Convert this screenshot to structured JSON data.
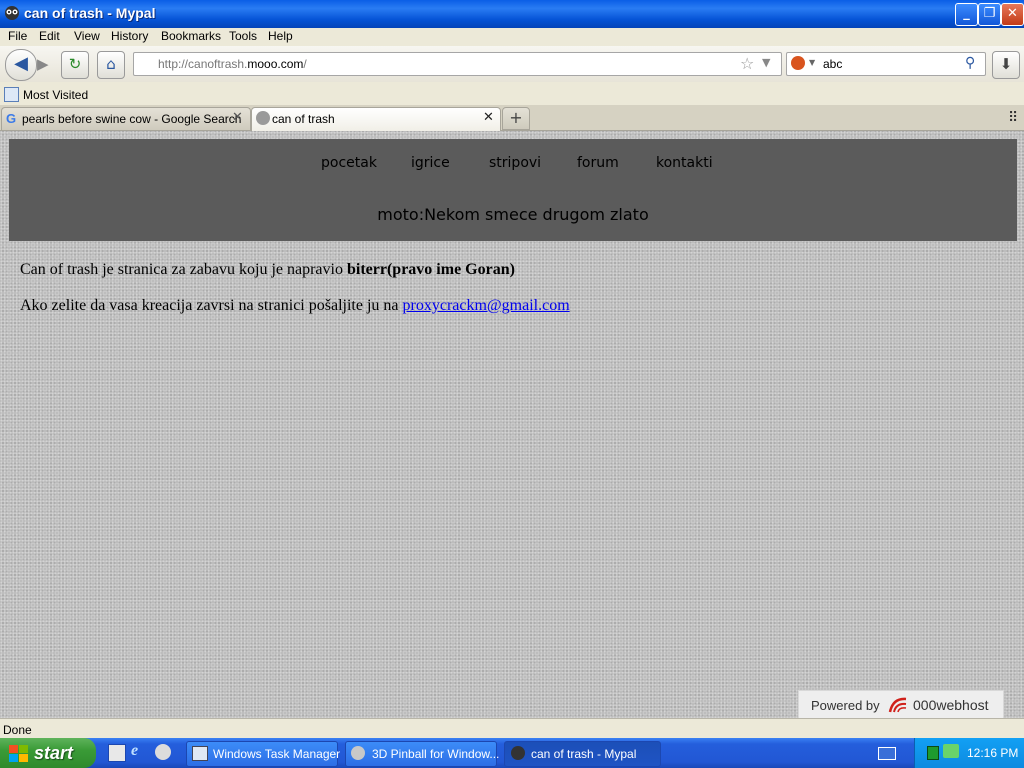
{
  "window": {
    "title": "can of trash - Mypal",
    "min": "_",
    "max": "❐",
    "close": "✕"
  },
  "menubar": {
    "items": [
      "File",
      "Edit",
      "View",
      "History",
      "Bookmarks",
      "Tools",
      "Help"
    ]
  },
  "toolbar": {
    "url_prefix": "http://canoftrash.",
    "url_domain": "mooo.com",
    "url_suffix": "/",
    "search_value": "abc"
  },
  "bookmarks": {
    "items": [
      "Most Visited"
    ]
  },
  "tabs": [
    {
      "label": "pearls before swine cow - Google Search"
    },
    {
      "label": "can of trash"
    }
  ],
  "page": {
    "nav": [
      "pocetak",
      "igrice",
      "stripovi",
      "forum",
      "kontakti"
    ],
    "moto": "moto:Nekom smece drugom zlato",
    "p1_text": "Can of trash je stranica za zabavu koju je napravio ",
    "p1_bold": "biterr(pravo  ime Goran)",
    "p2_text": "Ako zelite da vasa kreacija zavrsi na stranici pošaljite ju na ",
    "p2_link": "proxycrackm@gmail.com",
    "powered_label": "Powered by",
    "powered_brand": "000webhost"
  },
  "status": {
    "text": "Done"
  },
  "taskbar": {
    "start": "start",
    "items": [
      "Windows Task Manager",
      "3D Pinball for Window...",
      "can of trash - Mypal"
    ],
    "clock": "12:16 PM"
  },
  "colors": {
    "header_bg": "#5b5b5b",
    "link": "#0000ee",
    "taskbar": "#245edc",
    "start": "#3a9b37"
  }
}
